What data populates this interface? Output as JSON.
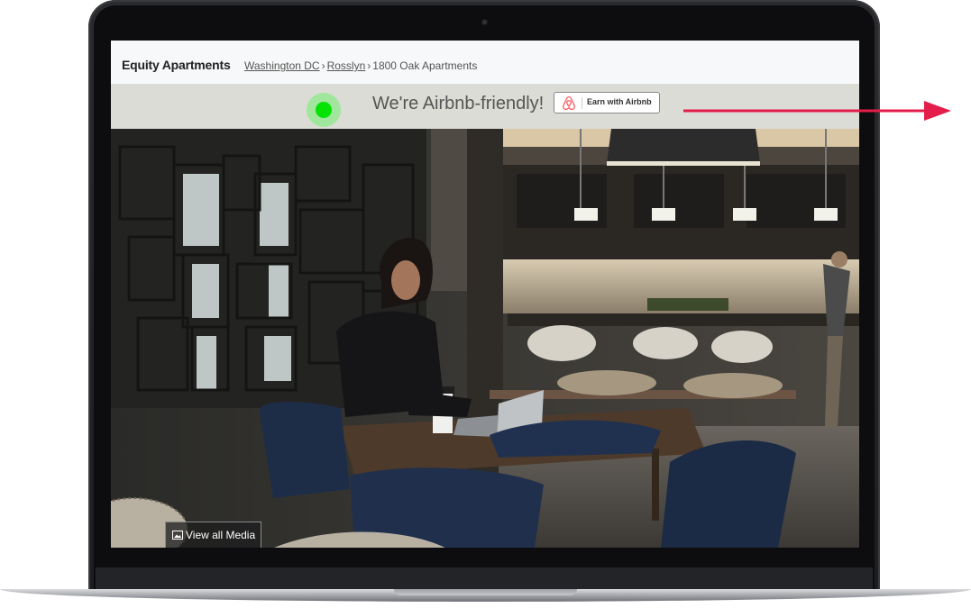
{
  "header": {
    "brand": "Equity Apartments",
    "breadcrumb": {
      "city": "Washington DC",
      "neighborhood": "Rosslyn",
      "property": "1800 Oak Apartments",
      "separator": "›"
    }
  },
  "airbnb_banner": {
    "message": "We're Airbnb-friendly!",
    "button_label": "Earn with Airbnb",
    "indicator_color": "#05e305",
    "airbnb_color": "#ff5a5f"
  },
  "media": {
    "view_all_label": "View all Media"
  },
  "annotation": {
    "arrow_color": "#e41d4a"
  }
}
